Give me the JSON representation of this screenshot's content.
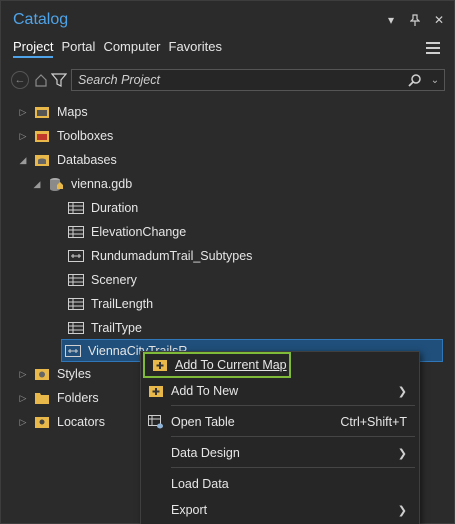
{
  "pane": {
    "title": "Catalog",
    "tabs": [
      "Project",
      "Portal",
      "Computer",
      "Favorites"
    ],
    "active_tab": "Project"
  },
  "toolbar": {
    "search_placeholder": "Search Project"
  },
  "tree": {
    "maps": "Maps",
    "toolboxes": "Toolboxes",
    "databases": "Databases",
    "gdb": "vienna.gdb",
    "items": [
      "Duration",
      "ElevationChange",
      "RundumadumTrail_Subtypes",
      "Scenery",
      "TrailLength",
      "TrailType"
    ],
    "selected": "ViennaCityTrailsR",
    "styles": "Styles",
    "folders": "Folders",
    "locators": "Locators"
  },
  "menu": {
    "add_current_map": "Add To Current Map",
    "add_new": "Add To New",
    "open_table": "Open Table",
    "open_table_shortcut": "Ctrl+Shift+T",
    "data_design": "Data Design",
    "load_data": "Load Data",
    "export": "Export"
  },
  "colors": {
    "accent": "#4fa3e8",
    "highlight_border": "#7fba38",
    "selected_row": "#1f4f7a",
    "folder_yellow": "#e8b84a"
  }
}
